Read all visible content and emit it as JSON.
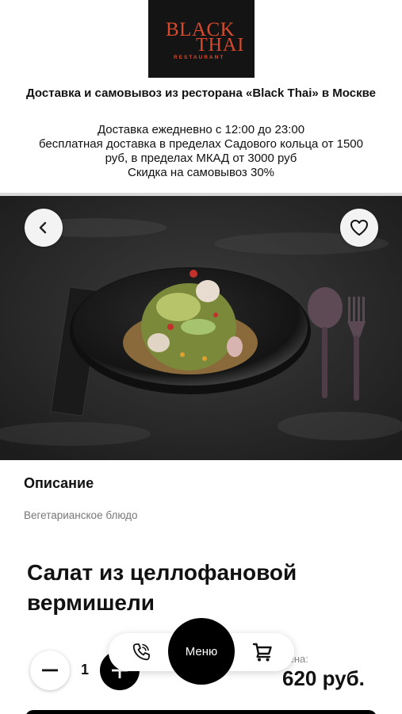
{
  "logo": {
    "line1": "BLACK",
    "line2": "THAI",
    "sub": "RESTAURANT"
  },
  "delivery": {
    "title": "Доставка и самовывоз из ресторана «Black Thai» в Москве",
    "lines": [
      "Доставка ежедневно с 12:00 до 23:00",
      "бесплатная доставка в пределах Садового кольца от 1500",
      "руб, в пределах МКАД от 3000 руб",
      "Скидка на самовывоз 30%"
    ]
  },
  "hero": {
    "back_icon": "chevron-left-icon",
    "favorite_icon": "heart-icon"
  },
  "description": {
    "title": "Описание",
    "text": "Вегетарианское блюдо"
  },
  "product": {
    "title": "Салат из целлофановой вермишели"
  },
  "quantity": {
    "value": "1"
  },
  "price": {
    "label": "Цена:",
    "value": "620 руб."
  },
  "nav": {
    "menu_label": "Меню",
    "phone_icon": "phone-icon",
    "cart_icon": "cart-icon"
  },
  "colors": {
    "logo_accent": "#d94a2c",
    "primary": "#000000"
  }
}
